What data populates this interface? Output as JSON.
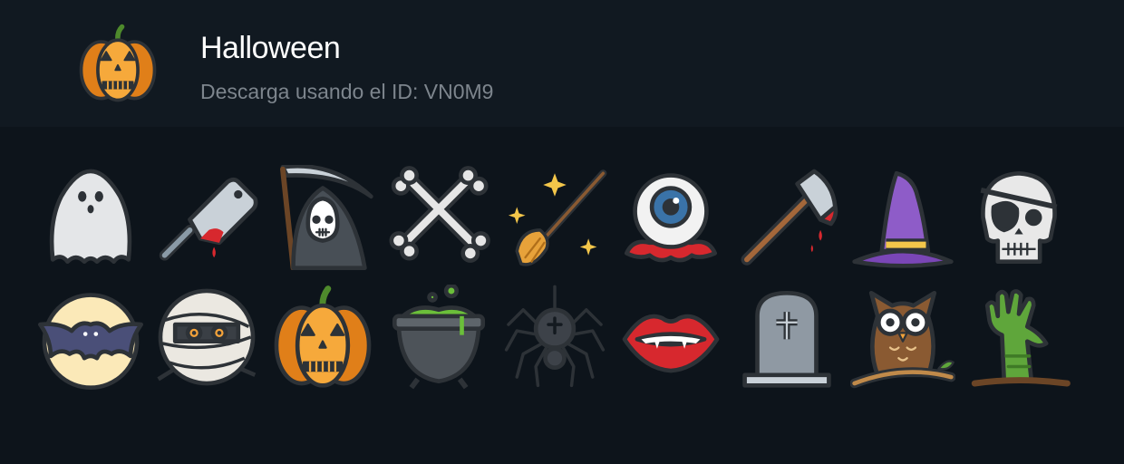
{
  "pack": {
    "title": "Halloween",
    "subtitle": "Descarga usando el ID: VN0M9",
    "logo_icon": "pumpkin-icon"
  },
  "icons": [
    {
      "name": "ghost-icon"
    },
    {
      "name": "cleaver-icon"
    },
    {
      "name": "grim-reaper-icon"
    },
    {
      "name": "crossed-bones-icon"
    },
    {
      "name": "magic-broom-icon"
    },
    {
      "name": "bloody-eyeball-icon"
    },
    {
      "name": "bloody-axe-icon"
    },
    {
      "name": "witch-hat-icon"
    },
    {
      "name": "pirate-skull-icon"
    },
    {
      "name": "bat-moon-icon"
    },
    {
      "name": "mummy-icon"
    },
    {
      "name": "jack-o-lantern-icon"
    },
    {
      "name": "cauldron-icon"
    },
    {
      "name": "spider-icon"
    },
    {
      "name": "vampire-lips-icon"
    },
    {
      "name": "tombstone-icon"
    },
    {
      "name": "owl-icon"
    },
    {
      "name": "zombie-hand-icon"
    }
  ],
  "colors": {
    "background": "#0d141b",
    "header": "#111921",
    "outline": "#2d3237",
    "pumpkin": "#f39a2b",
    "blood": "#d7282e",
    "purple": "#8e5cc8",
    "zombie": "#5fa63b"
  }
}
